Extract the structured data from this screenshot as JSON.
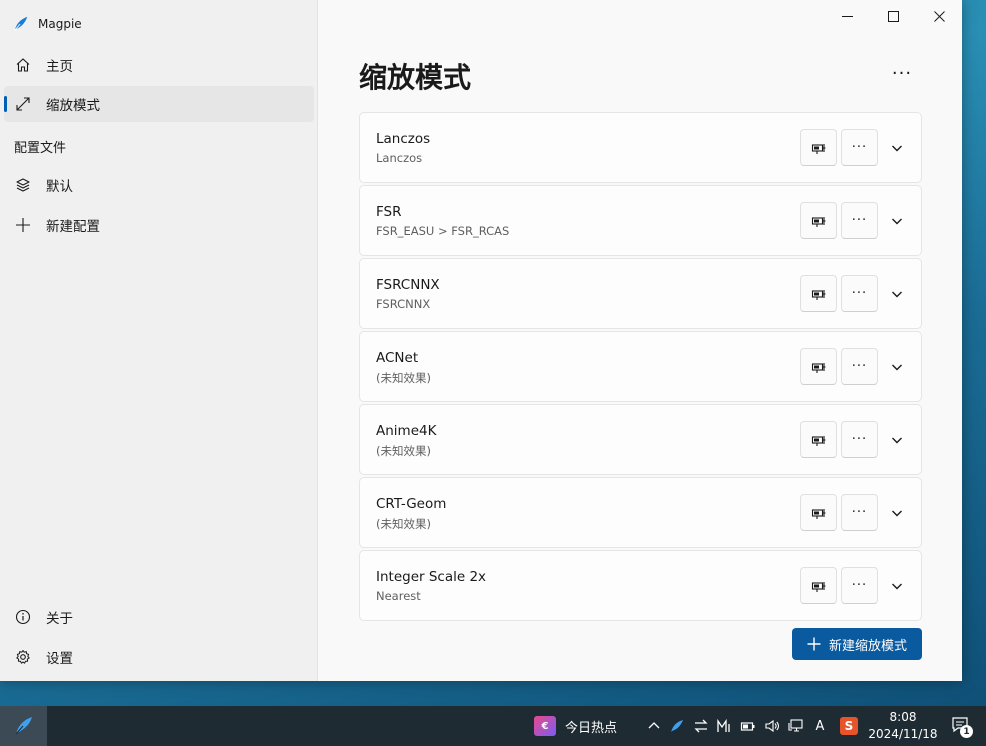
{
  "app": {
    "title": "Magpie"
  },
  "sidebar": {
    "items": [
      {
        "label": "主页",
        "icon": "home-icon",
        "selected": false
      },
      {
        "label": "缩放模式",
        "icon": "resize-icon",
        "selected": true
      }
    ],
    "section_label": "配置文件",
    "profiles": [
      {
        "label": "默认",
        "icon": "layers-icon"
      },
      {
        "label": "新建配置",
        "icon": "plus-icon"
      }
    ],
    "footer": [
      {
        "label": "关于",
        "icon": "info-icon"
      },
      {
        "label": "设置",
        "icon": "gear-icon"
      }
    ]
  },
  "window_controls": {
    "minimize": "minimize-icon",
    "maximize": "maximize-icon",
    "close": "close-icon"
  },
  "main": {
    "title": "缩放模式",
    "more_label": "···",
    "scaling_modes": [
      {
        "name": "Lanczos",
        "effects": "Lanczos"
      },
      {
        "name": "FSR",
        "effects": "FSR_EASU > FSR_RCAS"
      },
      {
        "name": "FSRCNNX",
        "effects": "FSRCNNX"
      },
      {
        "name": "ACNet",
        "effects": "(未知效果)"
      },
      {
        "name": "Anime4K",
        "effects": "(未知效果)"
      },
      {
        "name": "CRT-Geom",
        "effects": "(未知效果)"
      },
      {
        "name": "Integer Scale 2x",
        "effects": "Nearest"
      }
    ],
    "card_more_label": "···",
    "new_button_label": "新建缩放模式"
  },
  "taskbar": {
    "news_icon_text": "€",
    "news_label": "今日热点",
    "ime_label": "A",
    "ime_s": "S",
    "time": "8:08",
    "date": "2024/11/18",
    "notification_count": "1"
  },
  "colors": {
    "accent": "#005fb8",
    "primary_button": "#0a5aa0",
    "sidebar_bg": "#f0f0f0",
    "content_bg": "#f9f9f9",
    "taskbar_bg": "#1f2b33"
  }
}
